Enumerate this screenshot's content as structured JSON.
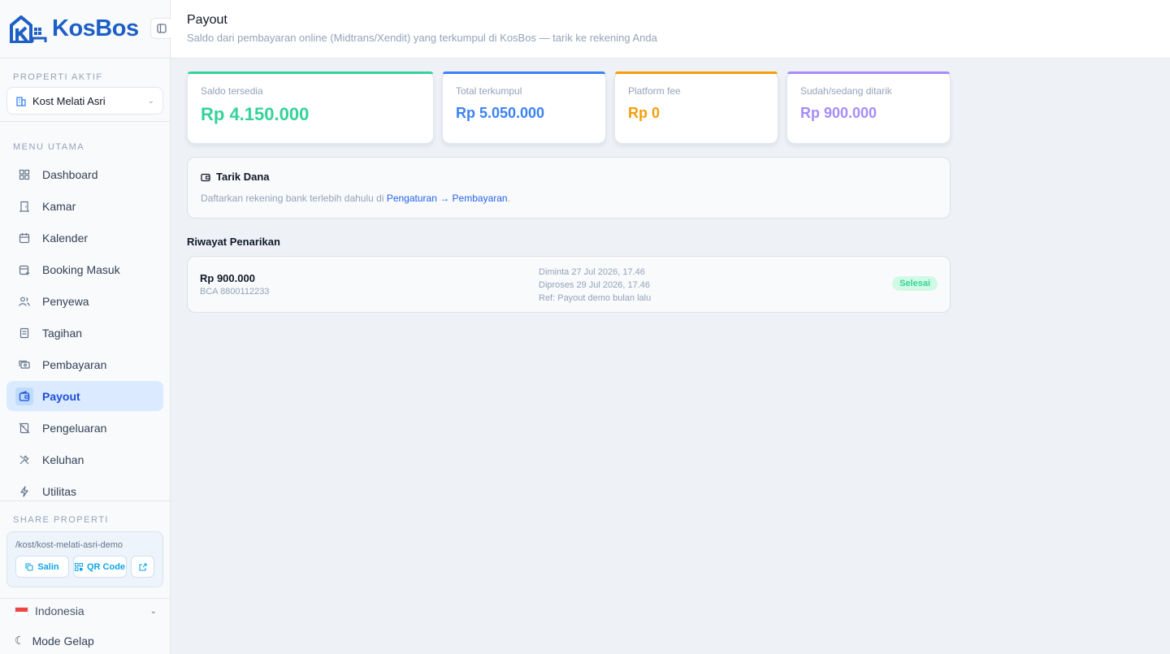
{
  "sidebar": {
    "logo": {
      "part1": "Kos",
      "part2": "Bos"
    },
    "property_section_label": "PROPERTI AKTIF",
    "selected_property": "Kost Melati Asri",
    "menu_section_label": "MENU UTAMA",
    "menu_items": [
      {
        "label": "Dashboard",
        "icon": "dashboard-icon"
      },
      {
        "label": "Kamar",
        "icon": "door-icon"
      },
      {
        "label": "Kalender",
        "icon": "calendar-icon"
      },
      {
        "label": "Booking Masuk",
        "icon": "calendar-plus-icon"
      },
      {
        "label": "Penyewa",
        "icon": "users-icon"
      },
      {
        "label": "Tagihan",
        "icon": "receipt-icon"
      },
      {
        "label": "Pembayaran",
        "icon": "money-icon"
      },
      {
        "label": "Payout",
        "icon": "wallet-icon",
        "active": true
      },
      {
        "label": "Pengeluaran",
        "icon": "receipt-off-icon"
      },
      {
        "label": "Keluhan",
        "icon": "tools-icon"
      },
      {
        "label": "Utilitas",
        "icon": "bolt-icon"
      }
    ],
    "share_section_label": "SHARE PROPERTI",
    "share_url": "/kost/kost-melati-asri-demo",
    "copy_label": "Salin",
    "qr_label": "QR Code",
    "language": "Indonesia",
    "dark_mode_label": "Mode Gelap"
  },
  "header": {
    "title": "Payout",
    "subtitle": "Saldo dari pembayaran online (Midtrans/Xendit) yang terkumpul di KosBos — tarik ke rekening Anda"
  },
  "stats": [
    {
      "label": "Saldo tersedia",
      "value": "Rp 4.150.000",
      "color": "#34d399"
    },
    {
      "label": "Total terkumpul",
      "value": "Rp 5.050.000",
      "color": "#3b82f6"
    },
    {
      "label": "Platform fee",
      "value": "Rp 0",
      "color": "#f59e0b"
    },
    {
      "label": "Sudah/sedang ditarik",
      "value": "Rp 900.000",
      "color": "#a78bfa"
    }
  ],
  "withdraw": {
    "title": "Tarik Dana",
    "text": "Daftarkan rekening bank terlebih dahulu di",
    "link": "Pengaturan → Pembayaran",
    "suffix": "."
  },
  "history": {
    "title": "Riwayat Penarikan",
    "rows": [
      {
        "amount": "Rp 900.000",
        "bank": "BCA 8800112233",
        "requested": "Diminta 27 Jul 2026, 17.46",
        "processed": "Diproses 29 Jul 2026, 17.46",
        "ref": "Ref: Payout demo bulan lalu",
        "status": "Selesai"
      }
    ]
  }
}
